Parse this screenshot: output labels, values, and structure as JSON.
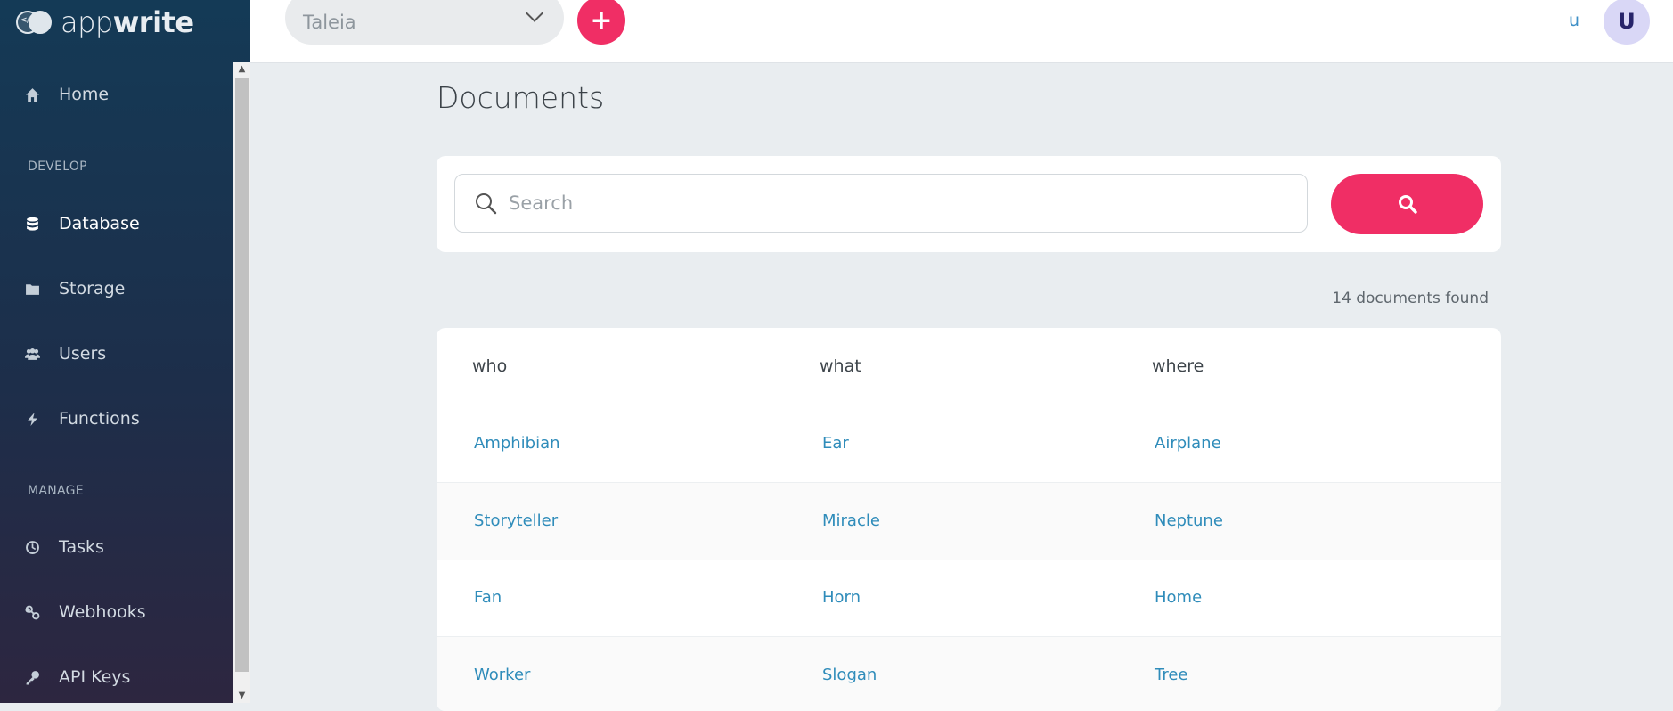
{
  "app": {
    "logo_light": "app",
    "logo_bold": "write"
  },
  "sidebar": {
    "items": [
      {
        "label": "Home",
        "icon": "home-icon"
      },
      {
        "label": "Database",
        "icon": "database-icon"
      },
      {
        "label": "Storage",
        "icon": "folder-icon"
      },
      {
        "label": "Users",
        "icon": "users-icon"
      },
      {
        "label": "Functions",
        "icon": "bolt-icon"
      },
      {
        "label": "Tasks",
        "icon": "clock-icon"
      },
      {
        "label": "Webhooks",
        "icon": "link-icon"
      },
      {
        "label": "API Keys",
        "icon": "key-icon"
      }
    ],
    "sections": {
      "develop": "DEVELOP",
      "manage": "MANAGE"
    }
  },
  "header": {
    "project": "Taleia",
    "add_label": "+",
    "user_link": "u",
    "avatar_initial": "U"
  },
  "main": {
    "title": "Documents",
    "search_placeholder": "Search",
    "count_text": "14 documents found",
    "columns": [
      "who",
      "what",
      "where"
    ],
    "rows": [
      [
        "Amphibian",
        "Ear",
        "Airplane"
      ],
      [
        "Storyteller",
        "Miracle",
        "Neptune"
      ],
      [
        "Fan",
        "Horn",
        "Home"
      ],
      [
        "Worker",
        "Slogan",
        "Tree"
      ]
    ]
  },
  "colors": {
    "accent": "#f02e65",
    "link": "#2f8cba",
    "sidebar_top": "#143a56",
    "sidebar_bottom": "#2d2640"
  }
}
